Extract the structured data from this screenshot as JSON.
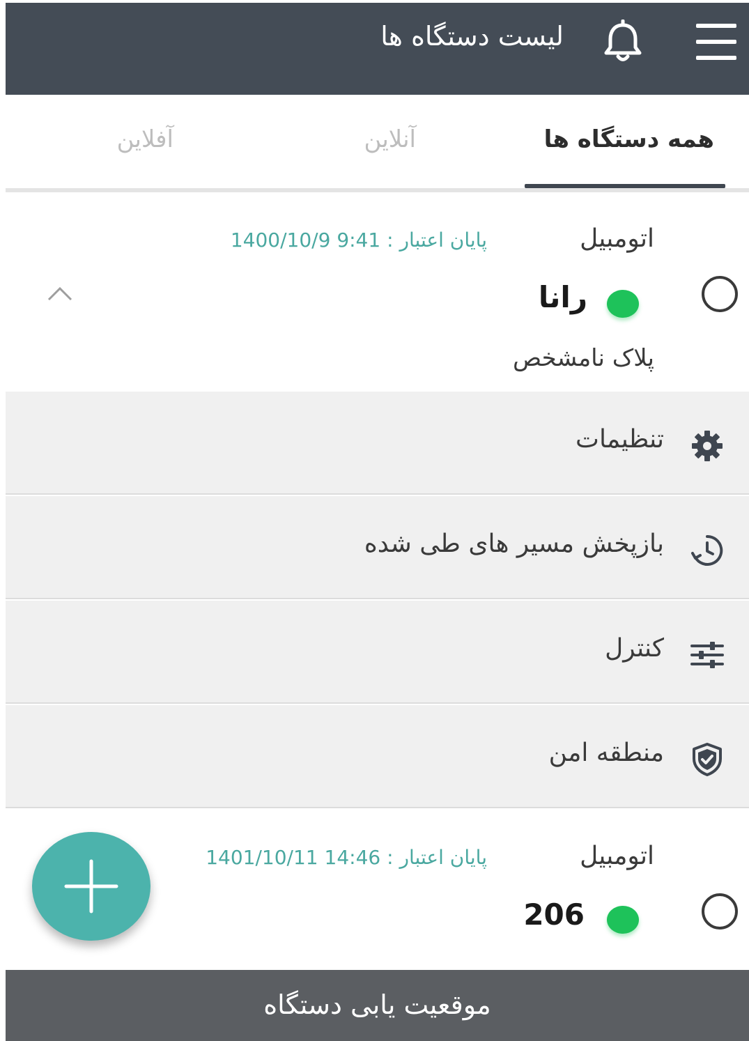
{
  "header": {
    "title": "لیست دستگاه ها",
    "menu_icon": "hamburger-menu-icon",
    "bell_icon": "bell-icon",
    "background_color": "#444c56"
  },
  "tabs": [
    {
      "label": "همه دستگاه ها",
      "active": true
    },
    {
      "label": "آنلاین",
      "active": false
    },
    {
      "label": "آفلاین",
      "active": false
    }
  ],
  "devices": [
    {
      "type": "اتومبیل",
      "expiry_label": "پایان اعتبار :",
      "expiry_value": "1400/10/9 9:41",
      "name": "رانا",
      "plate": "پلاک نامشخص",
      "status_color": "#1ec25a",
      "expanded": true
    },
    {
      "type": "اتومبیل",
      "expiry_label": "پایان اعتبار :",
      "expiry_value": "1401/10/11 14:46",
      "name": "206",
      "status_color": "#1ec25a",
      "expanded": false
    }
  ],
  "device_menu": [
    {
      "label": "تنظیمات",
      "icon": "gear-icon"
    },
    {
      "label": "بازپخش مسیر های طی شده",
      "icon": "history-playback-icon"
    },
    {
      "label": "کنترل",
      "icon": "sliders-icon"
    },
    {
      "label": "منطقه امن",
      "icon": "shield-check-icon"
    }
  ],
  "fab": {
    "icon": "plus-icon",
    "color": "#4cb3ac"
  },
  "bottom_bar": {
    "label": "موقعیت یابی دستگاه",
    "color": "#5b5e62"
  },
  "colors": {
    "accent_teal": "#4aa8a0",
    "online_green": "#1ec25a"
  }
}
